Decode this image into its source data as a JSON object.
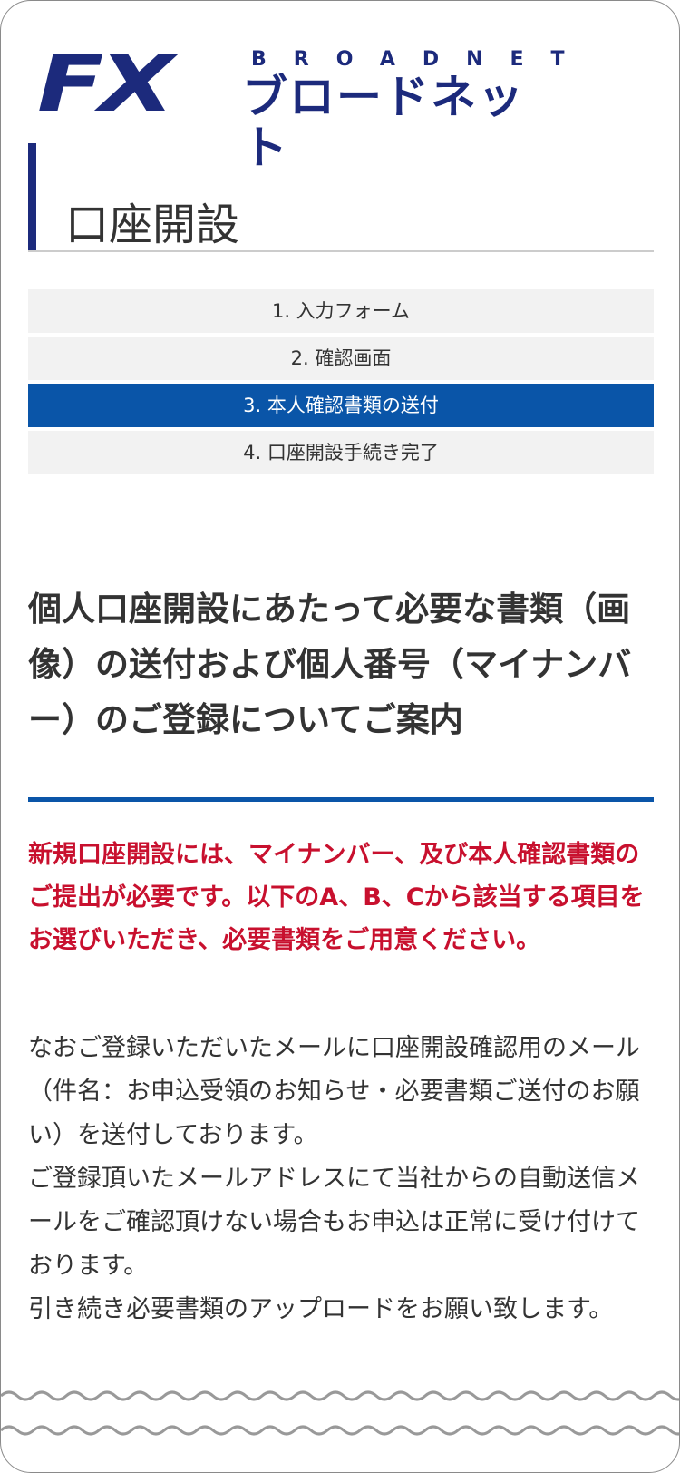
{
  "logo": {
    "mark": "FX",
    "en": "BROADNET",
    "ja": "ブロードネット"
  },
  "page": {
    "title": "口座開設"
  },
  "steps": [
    {
      "label": "1. 入力フォーム",
      "active": false
    },
    {
      "label": "2. 確認画面",
      "active": false
    },
    {
      "label": "3. 本人確認書類の送付",
      "active": true
    },
    {
      "label": "4. 口座開設手続き完了",
      "active": false
    }
  ],
  "content": {
    "heading": "個人口座開設にあたって必要な書類（画像）の送付および個人番号（マイナンバー）のご登録についてご案内",
    "notice": "新規口座開設には、マイナンバー、及び本人確認書類のご提出が必要です。以下のA、B、Cから該当する項目をお選びいただき、必要書類をご用意ください。",
    "paragraphs": [
      "なおご登録いただいたメールに口座開設確認用のメール（件名：お申込受領のお知らせ・必要書類ご送付のお願い）を送付しております。",
      "ご登録頂いたメールアドレスにて当社からの自動送信メールをご確認頂けない場合もお申込は正常に受け付けております。",
      "引き続き必要書類のアップロードをお願い致します。"
    ]
  },
  "colors": {
    "brand": "#1c2a7c",
    "active_step": "#0a55a8",
    "notice": "#c8102e"
  }
}
